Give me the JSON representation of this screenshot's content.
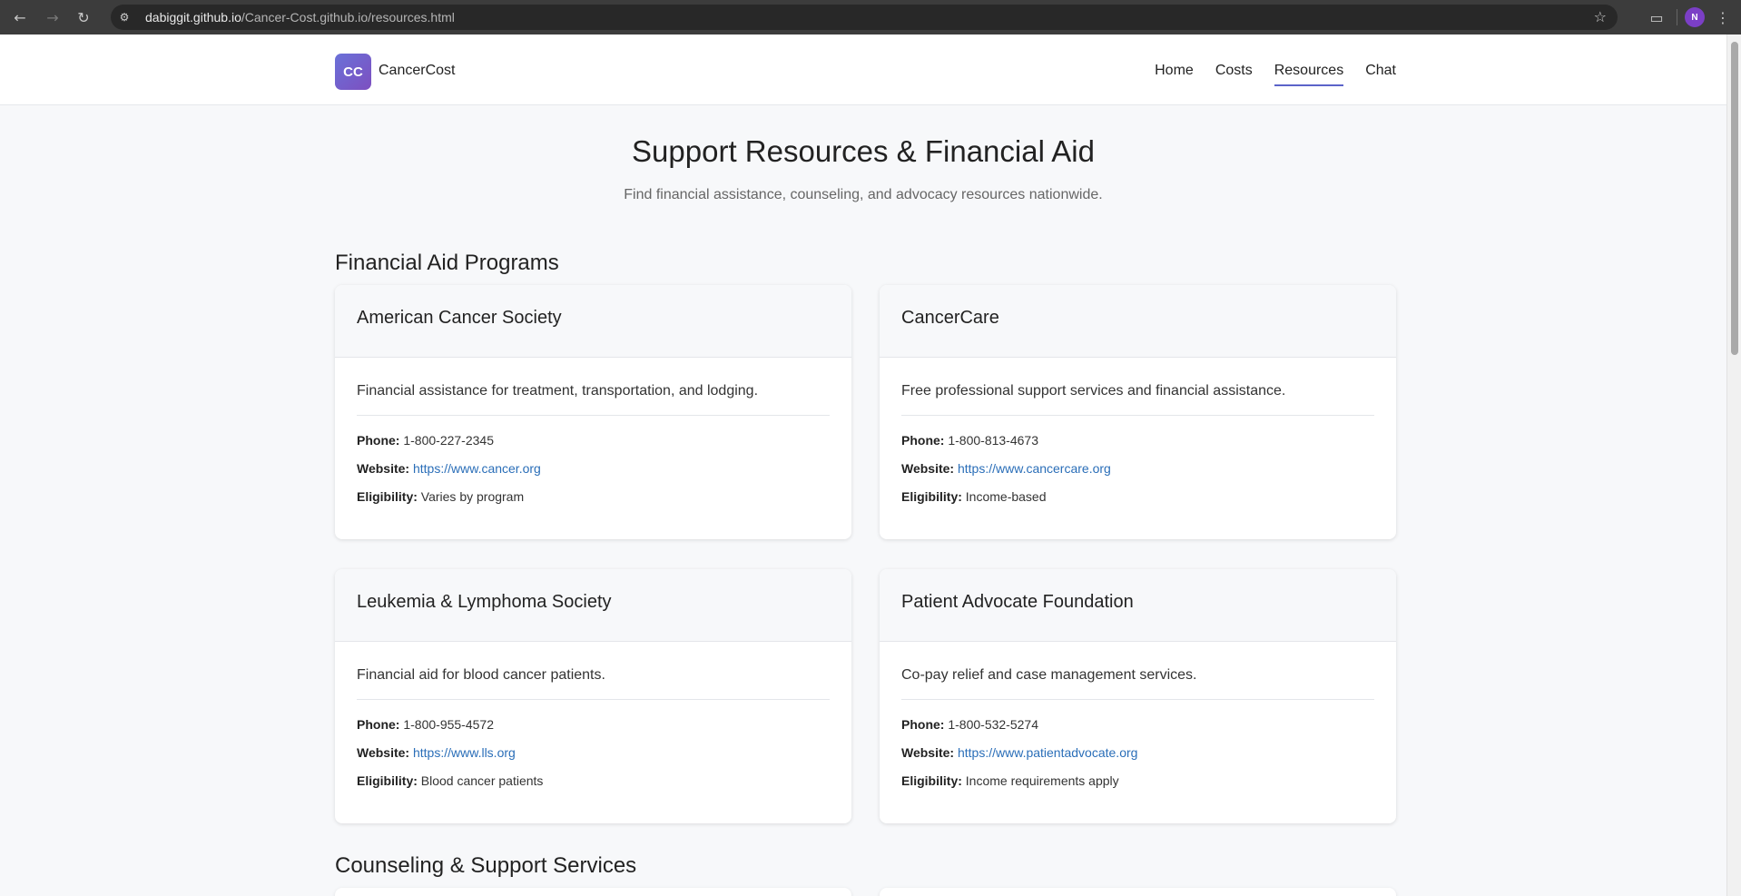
{
  "browser": {
    "url_host": "dabiggit.github.io",
    "url_path": "/Cancer-Cost.github.io/resources.html",
    "profile_initial": "N"
  },
  "header": {
    "logo_text": "CC",
    "brand": "CancerCost",
    "nav": [
      {
        "label": "Home"
      },
      {
        "label": "Costs"
      },
      {
        "label": "Resources"
      },
      {
        "label": "Chat"
      }
    ],
    "active_nav": "Resources"
  },
  "hero": {
    "title": "Support Resources & Financial Aid",
    "subtitle": "Find financial assistance, counseling, and advocacy resources nationwide."
  },
  "sections": {
    "financial_aid": "Financial Aid Programs",
    "counseling": "Counseling & Support Services"
  },
  "labels": {
    "phone": "Phone:",
    "website": "Website:",
    "eligibility": "Eligibility:"
  },
  "cards": [
    {
      "title": "American Cancer Society",
      "desc": "Financial assistance for treatment, transportation, and lodging.",
      "phone": "1-800-227-2345",
      "website": "https://www.cancer.org",
      "eligibility": "Varies by program"
    },
    {
      "title": "CancerCare",
      "desc": "Free professional support services and financial assistance.",
      "phone": "1-800-813-4673",
      "website": "https://www.cancercare.org",
      "eligibility": "Income-based"
    },
    {
      "title": "Leukemia & Lymphoma Society",
      "desc": "Financial aid for blood cancer patients.",
      "phone": "1-800-955-4572",
      "website": "https://www.lls.org",
      "eligibility": "Blood cancer patients"
    },
    {
      "title": "Patient Advocate Foundation",
      "desc": "Co-pay relief and case management services.",
      "phone": "1-800-532-5274",
      "website": "https://www.patientadvocate.org",
      "eligibility": "Income requirements apply"
    }
  ],
  "colors": {
    "accent": "#5b63c9",
    "link": "#2a6eb8",
    "logo_gradient_start": "#6a71d8",
    "logo_gradient_end": "#7d4fc0"
  }
}
